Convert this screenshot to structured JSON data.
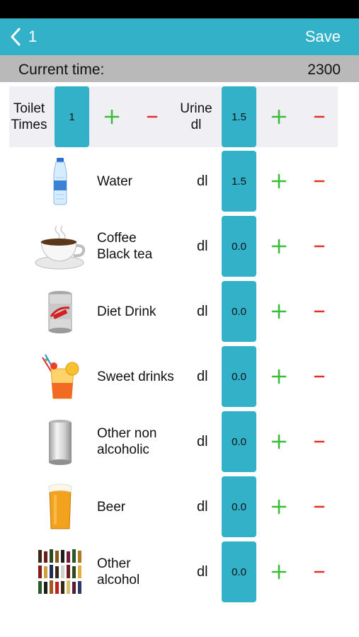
{
  "nav": {
    "back_label": "1",
    "save_label": "Save"
  },
  "current_time": {
    "label": "Current time:",
    "value": "2300"
  },
  "toilet": {
    "times_label_line1": "Toilet",
    "times_label_line2": "Times",
    "times_value": "1",
    "urine_label_line1": "Urine",
    "urine_label_line2": "dl",
    "urine_value": "1.5"
  },
  "drinks": [
    {
      "name": "Water",
      "unit": "dl",
      "value": "1.5",
      "icon": "water-bottle-icon"
    },
    {
      "name": "Coffee\nBlack tea",
      "unit": "dl",
      "value": "0.0",
      "icon": "coffee-cup-icon"
    },
    {
      "name": "Diet Drink",
      "unit": "dl",
      "value": "0.0",
      "icon": "diet-can-icon"
    },
    {
      "name": "Sweet drinks",
      "unit": "dl",
      "value": "0.0",
      "icon": "cocktail-icon"
    },
    {
      "name": "Other non\nalcoholic",
      "unit": "dl",
      "value": "0.0",
      "icon": "silver-can-icon"
    },
    {
      "name": "Beer",
      "unit": "dl",
      "value": "0.0",
      "icon": "beer-glass-icon"
    },
    {
      "name": "Other\nalcohol",
      "unit": "dl",
      "value": "0.0",
      "icon": "liquor-bottles-icon"
    }
  ],
  "colors": {
    "accent": "#33b1c9",
    "plus": "#3dbb3d",
    "minus": "#e0302a",
    "time_bar": "#b9b9b9"
  }
}
